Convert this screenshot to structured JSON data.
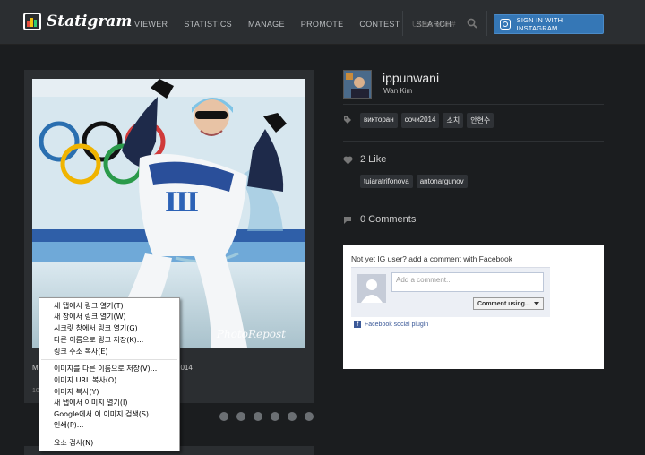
{
  "app": {
    "logo_text": "Statigram",
    "nav": [
      "VIEWER",
      "STATISTICS",
      "MANAGE",
      "PROMOTE",
      "CONTEST",
      "SEARCH"
    ],
    "search_placeholder": "Users and #",
    "signin_label": "SIGN IN WITH INSTAGRAM"
  },
  "photo": {
    "watermark": "PhotoRepost",
    "caption_left": "M",
    "caption_right": "2014",
    "meta": "10"
  },
  "profile": {
    "username": "ippunwani",
    "fullname": "Wan Kim"
  },
  "tags": [
    "викторан",
    "сочи2014",
    "소치",
    "안현수"
  ],
  "likes": {
    "label": "2 Like",
    "users": [
      "tuiaratrifonova",
      "antonargunov"
    ]
  },
  "comments": {
    "label": "0 Comments"
  },
  "facebook": {
    "title": "Not yet IG user? add a comment with Facebook",
    "placeholder": "Add a comment...",
    "button": "Comment using...",
    "plugin": "Facebook social plugin"
  },
  "context_menu": {
    "items": [
      "새 탭에서 링크 열기(T)",
      "새 창에서 링크 열기(W)",
      "시크릿 창에서 링크 열기(G)",
      "다른 이름으로 링크 저장(K)...",
      "링크 주소 복사(E)",
      "이미지를 다른 이름으로 저장(V)...",
      "이미지 URL 복사(O)",
      "이미지 복사(Y)",
      "새 탭에서 이미지 열기(I)",
      "Google에서 이 이미지 검색(S)",
      "인쇄(P)...",
      "요소 검사(N)"
    ]
  },
  "colors": {
    "background": "#1b1d1f",
    "topbar": "#2b2e31",
    "signin": "#3577b6",
    "facebook": "#3b5998"
  }
}
